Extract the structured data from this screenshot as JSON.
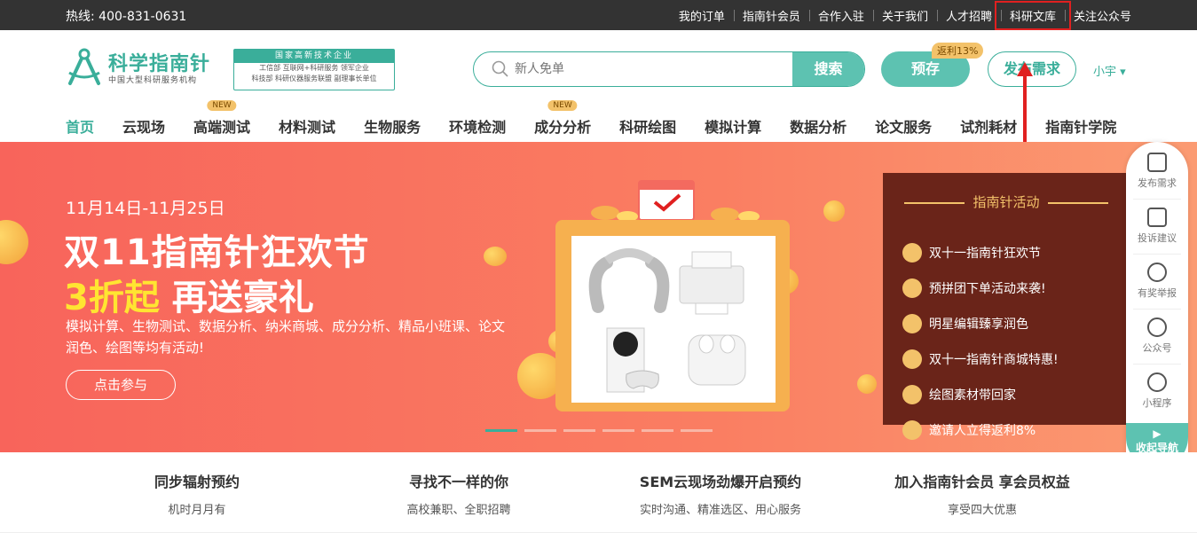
{
  "topbar": {
    "hotline": "热线: 400-831-0631",
    "links": [
      "我的订单",
      "指南针会员",
      "合作入驻",
      "关于我们",
      "人才招聘",
      "科研文库",
      "关注公众号"
    ]
  },
  "logo": {
    "title": "科学指南针",
    "subtitle": "中国大型科研服务机构"
  },
  "cert": {
    "head": "国家高新技术企业",
    "line1": "工信部 互联网+科研服务 领军企业",
    "line2": "科技部 科研仪器服务联盟 副理事长单位"
  },
  "search": {
    "placeholder": "新人免单",
    "button": "搜索"
  },
  "header_buttons": {
    "prestore": "预存",
    "rebate": "返利13%",
    "post": "发布需求",
    "user": "小宇 ▾"
  },
  "nav": [
    {
      "label": "首页",
      "badge": ""
    },
    {
      "label": "云现场",
      "badge": ""
    },
    {
      "label": "高端测试",
      "badge": "NEW"
    },
    {
      "label": "材料测试",
      "badge": ""
    },
    {
      "label": "生物服务",
      "badge": ""
    },
    {
      "label": "环境检测",
      "badge": ""
    },
    {
      "label": "成分分析",
      "badge": "NEW"
    },
    {
      "label": "科研绘图",
      "badge": ""
    },
    {
      "label": "模拟计算",
      "badge": ""
    },
    {
      "label": "数据分析",
      "badge": ""
    },
    {
      "label": "论文服务",
      "badge": ""
    },
    {
      "label": "试剂耗材",
      "badge": ""
    },
    {
      "label": "指南针学院",
      "badge": ""
    }
  ],
  "banner": {
    "date": "11月14日-11月25日",
    "headline": "双11指南针狂欢节",
    "sub_yellow": "3折起",
    "sub_white": " 再送豪礼",
    "desc": "模拟计算、生物测试、数据分析、纳米商城、成分分析、精品小班课、论文润色、绘图等均有活动!",
    "cta": "点击参与"
  },
  "activity": {
    "title": "指南针活动",
    "items": [
      "双十一指南针狂欢节",
      "预拼团下单活动来袭!",
      "明星编辑臻享润色",
      "双十一指南针商城特惠!",
      "绘图素材带回家",
      "邀请人立得返利8%"
    ]
  },
  "side": {
    "items": [
      "发布需求",
      "投诉建议",
      "有奖举报",
      "公众号",
      "小程序"
    ],
    "collapse": "收起导航"
  },
  "features": [
    {
      "title": "同步辐射预约",
      "desc": "机时月月有"
    },
    {
      "title": "寻找不一样的你",
      "desc": "高校兼职、全职招聘"
    },
    {
      "title": "SEM云现场劲爆开启预约",
      "desc": "实时沟通、精准选区、用心服务"
    },
    {
      "title": "加入指南针会员 享会员权益",
      "desc": "享受四大优惠"
    }
  ],
  "colors": {
    "brand": "#3aae9a",
    "brand_light": "#5dc2b1",
    "banner": "#f8645b",
    "accent_yellow": "#ffe531",
    "highlight_box": "#e02020"
  }
}
